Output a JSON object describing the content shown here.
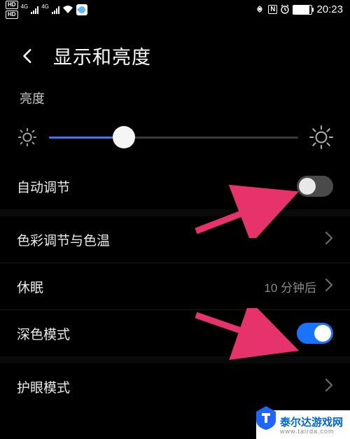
{
  "status_bar": {
    "hd_badge": "HD",
    "net_badge": "4G",
    "clock": "20:23",
    "nfc": "N"
  },
  "header": {
    "title": "显示和亮度"
  },
  "brightness": {
    "label": "亮度",
    "percent": 30
  },
  "rows": {
    "auto": {
      "label": "自动调节",
      "on": false
    },
    "color": {
      "label": "色彩调节与色温"
    },
    "sleep": {
      "label": "休眠",
      "value": "10 分钟后"
    },
    "dark": {
      "label": "深色模式",
      "on": true
    },
    "eye": {
      "label": "护眼模式"
    }
  },
  "watermark": {
    "text": "泰尔达游戏网",
    "sub": "www.tairda.com"
  }
}
